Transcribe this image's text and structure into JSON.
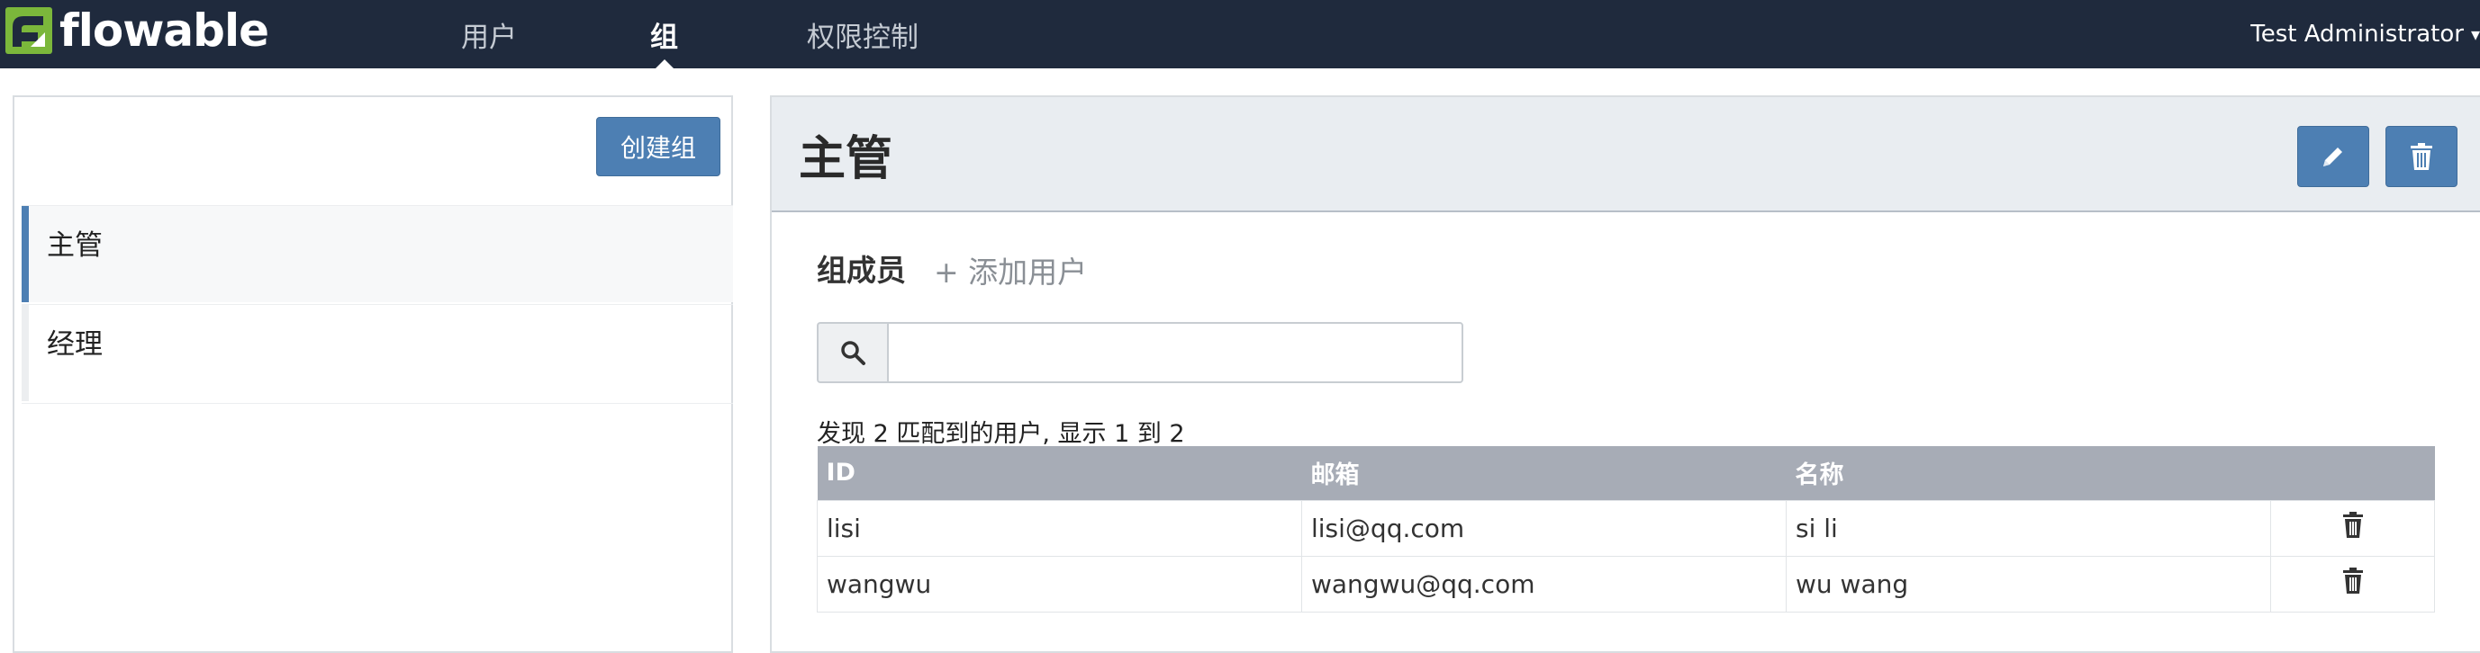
{
  "navbar": {
    "brand": "flowable",
    "tabs": [
      {
        "label": "用户",
        "active": false
      },
      {
        "label": "组",
        "active": true
      },
      {
        "label": "权限控制",
        "active": false
      }
    ],
    "user": "Test Administrator",
    "background_color": "#1f2a3d",
    "brand_color": "#7bb73b"
  },
  "sidebar": {
    "create_button": "创建组",
    "groups": [
      {
        "label": "主管",
        "selected": true
      },
      {
        "label": "经理",
        "selected": false
      }
    ]
  },
  "detail": {
    "title": "主管",
    "edit_icon": "pencil-icon",
    "delete_icon": "trash-icon",
    "members_heading": "组成员",
    "add_user": "+ 添加用户",
    "search": {
      "value": "",
      "placeholder": ""
    },
    "result_info": "发现 2 匹配到的用户, 显示 1 到 2",
    "table": {
      "columns": [
        "ID",
        "邮箱",
        "名称"
      ],
      "rows": [
        {
          "id": "lisi",
          "email": "lisi@qq.com",
          "name": "si li"
        },
        {
          "id": "wangwu",
          "email": "wangwu@qq.com",
          "name": "wu wang"
        }
      ]
    },
    "accent_color": "#4d7fb3"
  }
}
